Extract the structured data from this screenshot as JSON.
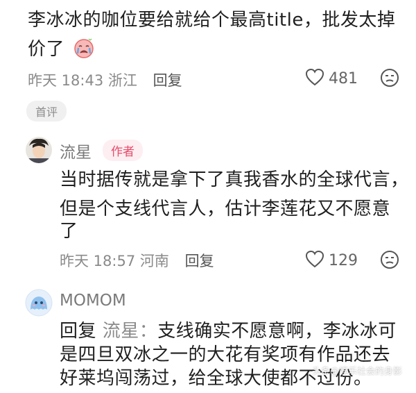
{
  "comment1": {
    "text_line1": "李冰冰的咖位要给就给个最高title，批发太掉",
    "text_line2": "价了",
    "emoji": "crying-face-emoji",
    "time": "昨天 18:43",
    "location": "浙江",
    "reply_label": "回复",
    "likes": "481",
    "badge": "首评"
  },
  "reply1": {
    "user": "流星",
    "author_badge": "作者",
    "line1": "当时据传就是拿下了真我香水的全球代言，",
    "line2": "但是个支线代言人，估计李莲花又不愿意",
    "line3": "了",
    "time": "昨天 18:57",
    "location": "河南",
    "reply_label": "回复",
    "likes": "129"
  },
  "reply2": {
    "user": "MOMOM",
    "prefix": "回复",
    "target": "流星：",
    "line1_rest": "支线确实不愿意啊，李冰冰可",
    "line2": "是四旦双冰之一的大花有奖项有作品还去",
    "line3": "好莱坞闯荡过，给全球大使都不过份。"
  },
  "watermark": "头条@娱乐社会的身影",
  "colors": {
    "author_badge": "#e64b6b",
    "meta": "#8a8a8a"
  }
}
